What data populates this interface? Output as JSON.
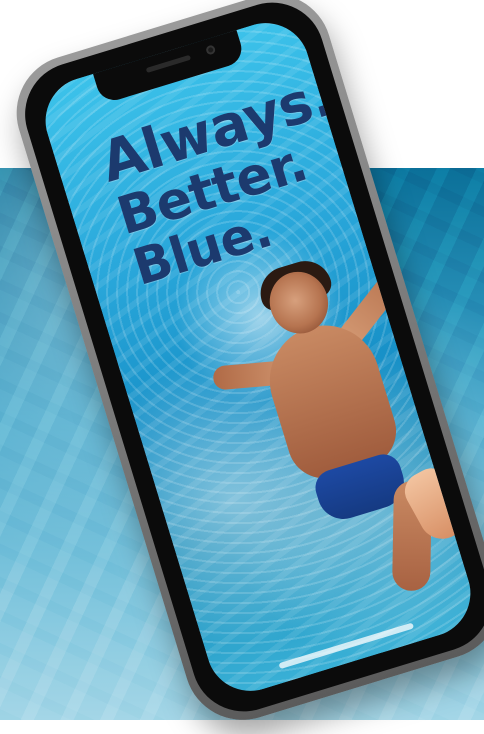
{
  "ad": {
    "headline": {
      "line1": "Always.",
      "line2": "Better.",
      "line3": "Blue."
    }
  }
}
